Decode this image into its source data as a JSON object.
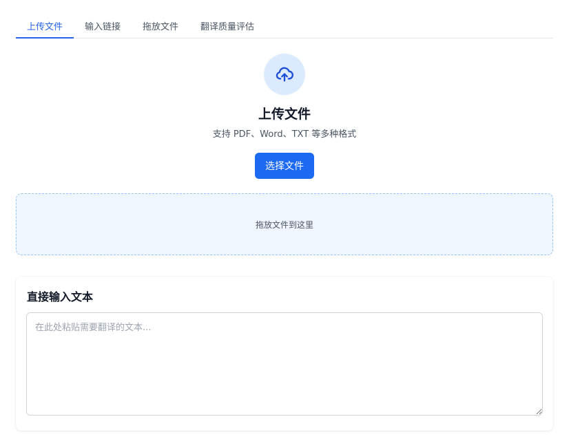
{
  "tabs": [
    {
      "label": "上传文件",
      "active": true
    },
    {
      "label": "输入链接",
      "active": false
    },
    {
      "label": "拖放文件",
      "active": false
    },
    {
      "label": "翻译质量评估",
      "active": false
    }
  ],
  "upload": {
    "icon": "cloud-upload-icon",
    "title": "上传文件",
    "subtitle": "支持 PDF、Word、TXT 等多种格式",
    "button_label": "选择文件"
  },
  "dropzone": {
    "text": "拖放文件到这里"
  },
  "text_input": {
    "title": "直接输入文本",
    "value": "",
    "placeholder": "在此处粘贴需要翻译的文本..."
  },
  "colors": {
    "accent": "#2563eb",
    "button": "#1d6af2",
    "icon_bg": "#dbeafe",
    "dropzone_bg": "#eff6ff",
    "dropzone_border": "#93c5fd"
  }
}
